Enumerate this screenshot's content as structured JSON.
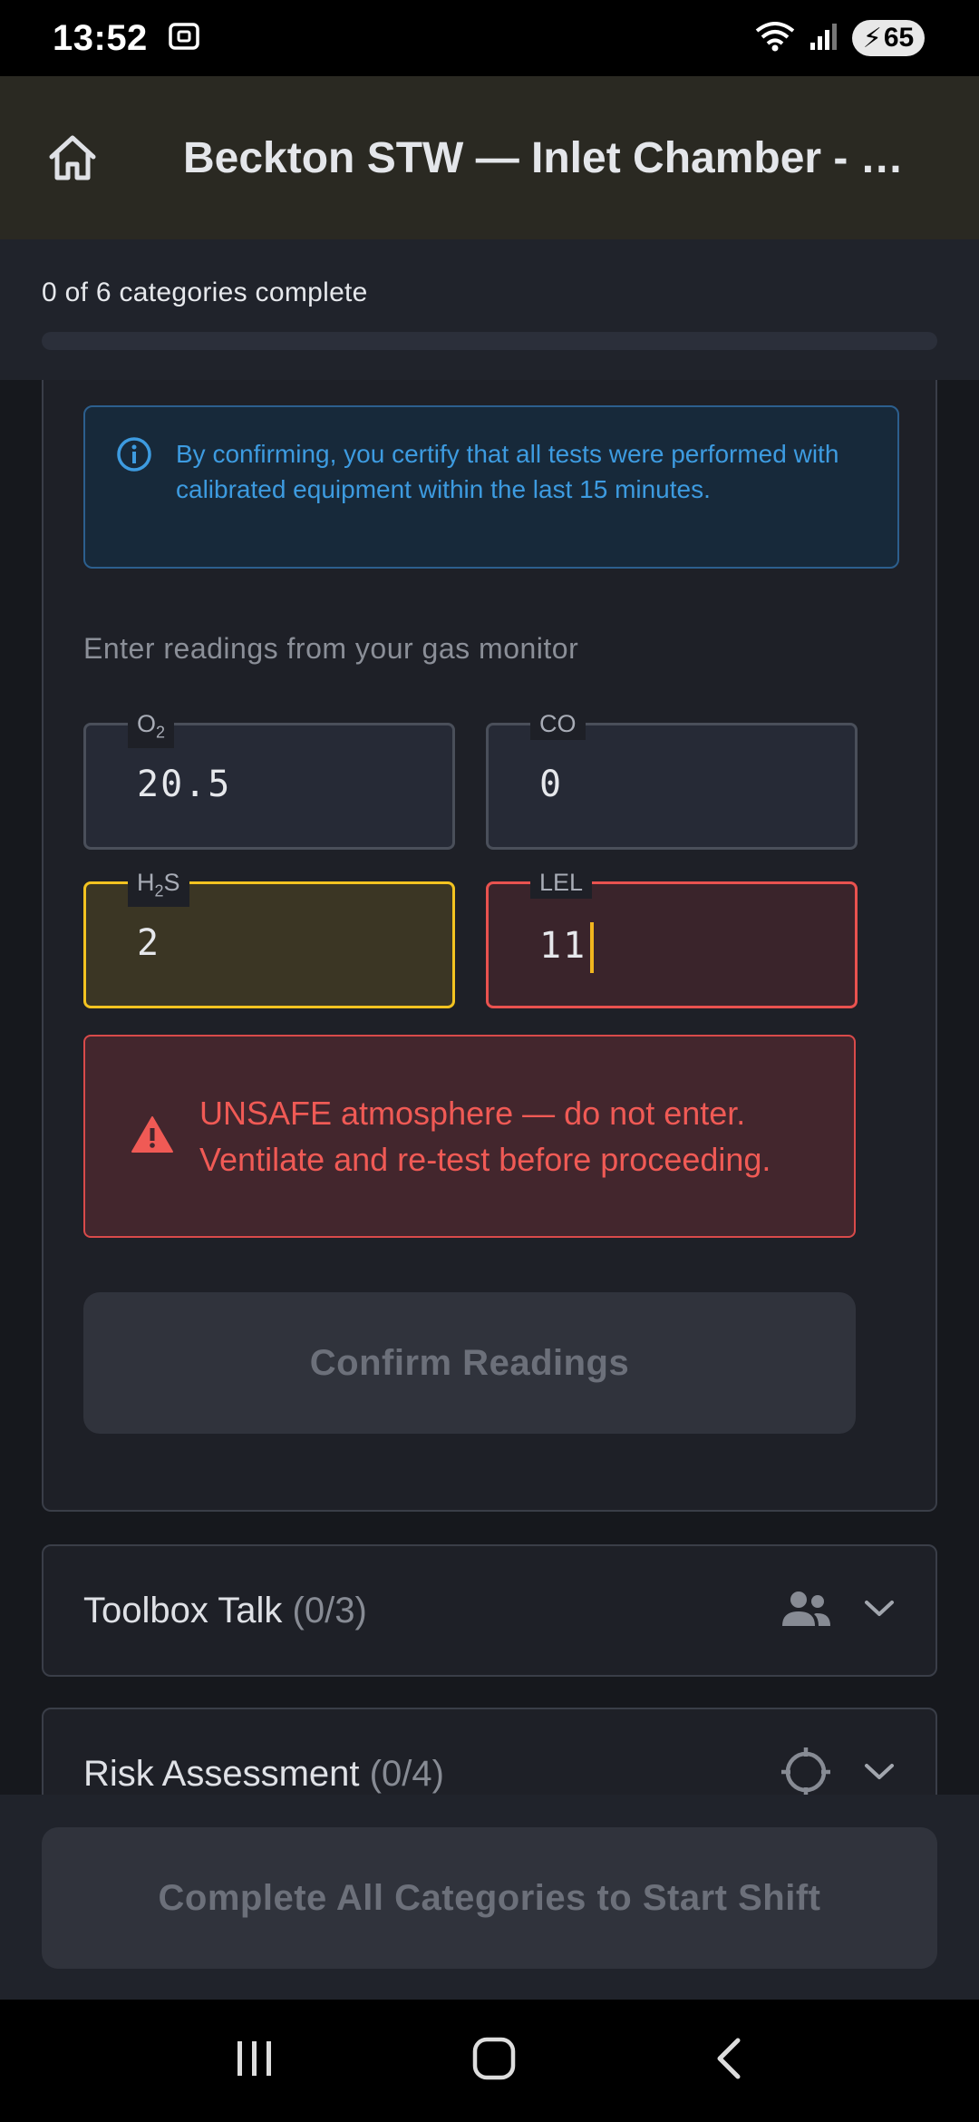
{
  "status_bar": {
    "time": "13:52",
    "battery": "65"
  },
  "app_bar": {
    "title": "Beckton STW — Inlet Chamber - C..."
  },
  "progress": {
    "text": "0 of 6 categories complete",
    "fraction": 0
  },
  "gas_test": {
    "info": "By confirming, you certify that all tests were performed with calibrated equipment within the last 15 minutes.",
    "readings_label": "Enter readings from your gas monitor",
    "fields": {
      "o2": {
        "label_main": "O",
        "label_sub": "2",
        "label_tail": "",
        "value": "20.5",
        "status": "normal"
      },
      "co": {
        "label": "CO",
        "value": "0",
        "status": "normal"
      },
      "h2s": {
        "label_main": "H",
        "label_sub": "2",
        "label_tail": "S",
        "value": "2",
        "status": "warning"
      },
      "lel": {
        "label": "LEL",
        "value": "11",
        "status": "danger"
      }
    },
    "alert": "UNSAFE atmosphere — do not enter. Ventilate and re-test before proceeding.",
    "confirm_label": "Confirm Readings"
  },
  "categories": [
    {
      "title": "Toolbox Talk",
      "count": "(0/3)",
      "icon": "people-icon"
    },
    {
      "title": "Risk Assessment",
      "count": "(0/4)",
      "icon": "crosshair-icon"
    }
  ],
  "bottom": {
    "start_label": "Complete All Categories to Start Shift"
  },
  "colors": {
    "accent_info": "#3d9be0",
    "warning": "#f3c320",
    "danger": "#e9524f"
  }
}
